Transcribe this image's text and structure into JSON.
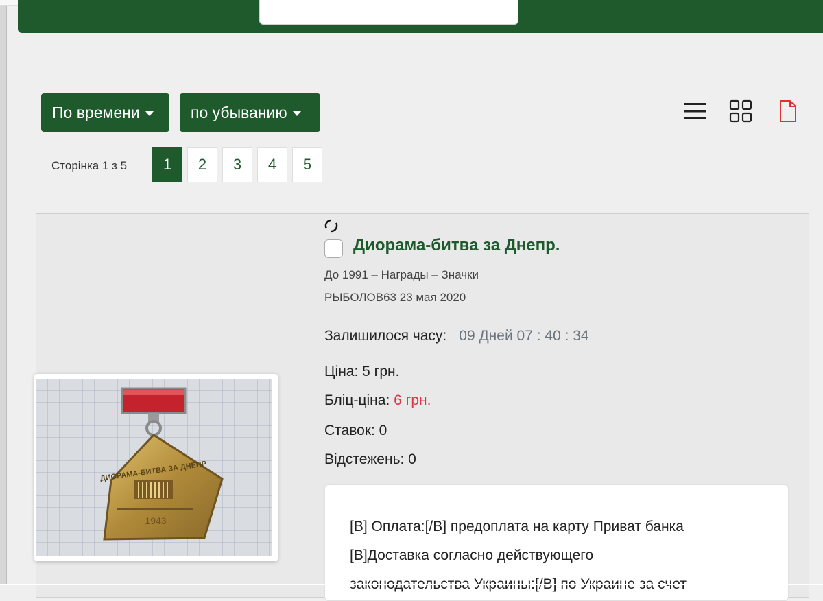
{
  "sort": {
    "by_label": "По времени",
    "order_label": "по убыванию"
  },
  "pager": {
    "label": "Сторінка 1 з 5",
    "pages": [
      "1",
      "2",
      "3",
      "4",
      "5"
    ],
    "current": "1"
  },
  "view_icons": [
    "list-view-icon",
    "grid-view-icon",
    "pdf-icon"
  ],
  "colors": {
    "brand_green": "#1f5a2d",
    "price_red": "#dc3545",
    "timer_gray": "#6c757d"
  },
  "item": {
    "title": "Диорама-битва за Днепр.",
    "breadcrumb": "До 1991 – Награды – Значки",
    "seller": "РЫБОЛОВ63 23 мая 2020",
    "time_left_label": "Залишилося часу:",
    "time_left_value": "09 Дней 07 : 40 : 34",
    "price": "Ціна: 5 грн.",
    "blitz_label": "Бліц-ціна:",
    "blitz_value": "6 грн.",
    "bids": "Ставок: 0",
    "watchers": "Відстежень: 0",
    "description": [
      "[B] Оплата:[/B] предоплата на карту Приват банка",
      "[B]Доставка согласно действующего",
      "законодательства Украины:[/B] по Украине за счет"
    ],
    "photo": {
      "badge_text_top": "ДИОРАМА-БИТВА ЗА ДНЕПР",
      "badge_year": "1943"
    }
  }
}
